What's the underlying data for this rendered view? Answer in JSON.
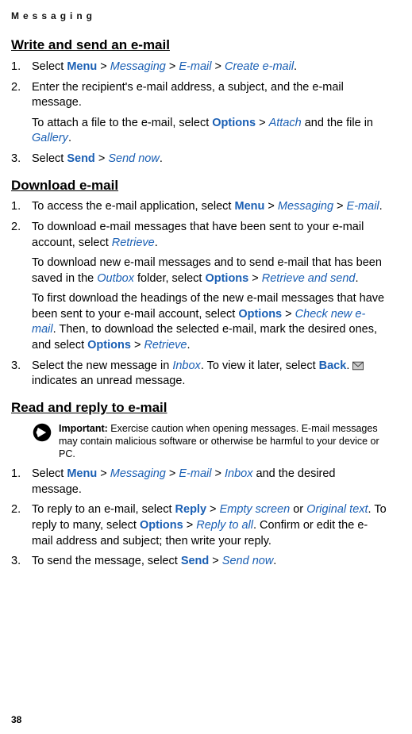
{
  "header": "Messaging",
  "page_number": "38",
  "sections": [
    {
      "title": "Write and send an e-mail",
      "items": [
        {
          "num": "1.",
          "runs": [
            {
              "t": "Select "
            },
            {
              "t": "Menu",
              "cls": "bold-blue"
            },
            {
              "t": " > "
            },
            {
              "t": "Messaging",
              "cls": "italic-blue"
            },
            {
              "t": " > "
            },
            {
              "t": "E-mail",
              "cls": "italic-blue"
            },
            {
              "t": " > "
            },
            {
              "t": "Create e-mail",
              "cls": "italic-blue"
            },
            {
              "t": "."
            }
          ]
        },
        {
          "num": "2.",
          "runs": [
            {
              "t": "Enter the recipient's e-mail address, a subject, and the e-mail message."
            }
          ],
          "sub": [
            {
              "runs": [
                {
                  "t": "To attach a file to the e-mail, select "
                },
                {
                  "t": "Options",
                  "cls": "bold-blue"
                },
                {
                  "t": " > "
                },
                {
                  "t": "Attach",
                  "cls": "italic-blue"
                },
                {
                  "t": " and the file in "
                },
                {
                  "t": "Gallery",
                  "cls": "italic-blue"
                },
                {
                  "t": "."
                }
              ]
            }
          ]
        },
        {
          "num": "3.",
          "runs": [
            {
              "t": "Select "
            },
            {
              "t": "Send",
              "cls": "bold-blue"
            },
            {
              "t": " > "
            },
            {
              "t": "Send now",
              "cls": "italic-blue"
            },
            {
              "t": "."
            }
          ]
        }
      ]
    },
    {
      "title": "Download e-mail",
      "items": [
        {
          "num": "1.",
          "runs": [
            {
              "t": "To access the e-mail application, select "
            },
            {
              "t": "Menu",
              "cls": "bold-blue"
            },
            {
              "t": " > "
            },
            {
              "t": "Messaging",
              "cls": "italic-blue"
            },
            {
              "t": " > "
            },
            {
              "t": "E-mail",
              "cls": "italic-blue"
            },
            {
              "t": "."
            }
          ]
        },
        {
          "num": "2.",
          "runs": [
            {
              "t": "To download e-mail messages that have been sent to your e-mail account, select "
            },
            {
              "t": "Retrieve",
              "cls": "italic-blue"
            },
            {
              "t": "."
            }
          ],
          "sub": [
            {
              "runs": [
                {
                  "t": "To download new e-mail messages and to send e-mail that has been saved in the "
                },
                {
                  "t": "Outbox",
                  "cls": "italic-blue"
                },
                {
                  "t": " folder, select "
                },
                {
                  "t": "Options",
                  "cls": "bold-blue"
                },
                {
                  "t": " > "
                },
                {
                  "t": "Retrieve and send",
                  "cls": "italic-blue"
                },
                {
                  "t": "."
                }
              ]
            },
            {
              "runs": [
                {
                  "t": "To first download the headings of the new e-mail messages that have been sent to your e-mail account, select "
                },
                {
                  "t": "Options",
                  "cls": "bold-blue"
                },
                {
                  "t": " > "
                },
                {
                  "t": "Check new e-mail",
                  "cls": "italic-blue"
                },
                {
                  "t": ". Then, to download the selected e-mail, mark the desired ones, and select "
                },
                {
                  "t": "Options",
                  "cls": "bold-blue"
                },
                {
                  "t": " > "
                },
                {
                  "t": "Retrieve",
                  "cls": "italic-blue"
                },
                {
                  "t": "."
                }
              ]
            }
          ]
        },
        {
          "num": "3.",
          "runs": [
            {
              "t": "Select the new message in "
            },
            {
              "t": "Inbox",
              "cls": "italic-blue"
            },
            {
              "t": ". To view it later, select "
            },
            {
              "t": "Back",
              "cls": "bold-blue"
            },
            {
              "t": ".  "
            },
            {
              "icon": "mail"
            },
            {
              "t": " indicates an unread message."
            }
          ]
        }
      ]
    },
    {
      "title": "Read and reply to e-mail",
      "important": {
        "label": "Important:",
        "text": " Exercise caution when opening messages. E-mail messages may contain malicious software or otherwise be harmful to your device or PC."
      },
      "items": [
        {
          "num": "1.",
          "runs": [
            {
              "t": "Select "
            },
            {
              "t": "Menu",
              "cls": "bold-blue"
            },
            {
              "t": " > "
            },
            {
              "t": "Messaging",
              "cls": "italic-blue"
            },
            {
              "t": " > "
            },
            {
              "t": "E-mail",
              "cls": "italic-blue"
            },
            {
              "t": " > "
            },
            {
              "t": "Inbox",
              "cls": "italic-blue"
            },
            {
              "t": " and the desired message."
            }
          ]
        },
        {
          "num": "2.",
          "runs": [
            {
              "t": "To reply to an e-mail, select "
            },
            {
              "t": "Reply",
              "cls": "bold-blue"
            },
            {
              "t": " > "
            },
            {
              "t": "Empty screen",
              "cls": "italic-blue"
            },
            {
              "t": " or "
            },
            {
              "t": "Original text",
              "cls": "italic-blue"
            },
            {
              "t": ". To reply to many, select "
            },
            {
              "t": "Options",
              "cls": "bold-blue"
            },
            {
              "t": " > "
            },
            {
              "t": "Reply to all",
              "cls": "italic-blue"
            },
            {
              "t": ". Confirm or edit the e-mail address and subject; then write your reply."
            }
          ]
        },
        {
          "num": "3.",
          "runs": [
            {
              "t": "To send the message, select "
            },
            {
              "t": "Send",
              "cls": "bold-blue"
            },
            {
              "t": " > "
            },
            {
              "t": "Send now",
              "cls": "italic-blue"
            },
            {
              "t": "."
            }
          ]
        }
      ]
    }
  ]
}
